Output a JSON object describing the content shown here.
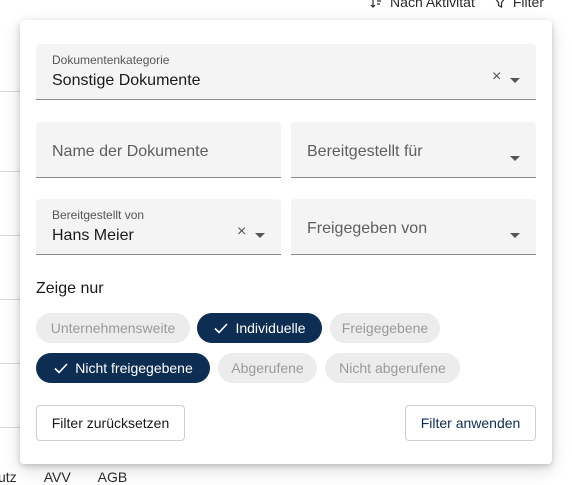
{
  "background": {
    "toolbar": {
      "sort_label": "Nach Aktivität",
      "filter_label": "Filter"
    },
    "tabs": [
      "utz",
      "AVV",
      "AGB"
    ]
  },
  "filter_panel": {
    "category": {
      "label": "Dokumentenkategorie",
      "value": "Sonstige Dokumente"
    },
    "name": {
      "placeholder": "Name der Dokumente"
    },
    "provided_for": {
      "placeholder": "Bereitgestellt für"
    },
    "provided_by": {
      "label": "Bereitgestellt von",
      "value": "Hans Meier"
    },
    "released_by": {
      "placeholder": "Freigegeben von"
    },
    "show_only": {
      "title": "Zeige nur",
      "chips": [
        {
          "label": "Unternehmensweite",
          "selected": false
        },
        {
          "label": "Individuelle",
          "selected": true
        },
        {
          "label": "Freigegebene",
          "selected": false
        },
        {
          "label": "Nicht freigegebene",
          "selected": true
        },
        {
          "label": "Abgerufene",
          "selected": false
        },
        {
          "label": "Nicht abgerufene",
          "selected": false
        }
      ]
    },
    "buttons": {
      "reset": "Filter zurücksetzen",
      "apply": "Filter anwenden"
    },
    "clear_symbol": "×"
  },
  "colors": {
    "accent": "#0d2d52",
    "chip_off": "#ececec",
    "field_bg": "#f4f4f4"
  }
}
